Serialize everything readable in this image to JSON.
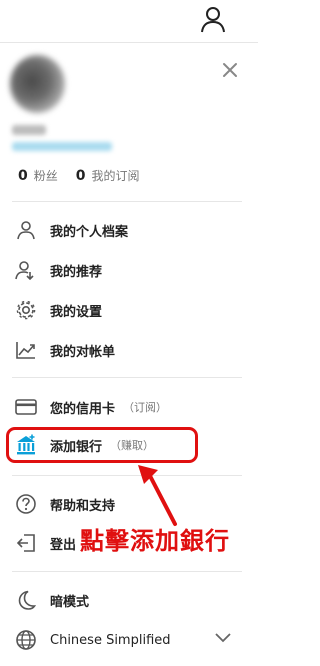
{
  "stats": {
    "followers_count": "0",
    "followers_label": "粉丝",
    "subscriptions_count": "0",
    "subscriptions_label": "我的订阅"
  },
  "menu": {
    "profile": "我的个人档案",
    "recommendations": "我的推荐",
    "settings": "我的设置",
    "statement": "我的对帐单",
    "credit_card": "您的信用卡",
    "credit_card_note": "（订阅）",
    "add_bank": "添加银行",
    "add_bank_note": "（赚取）",
    "help": "帮助和支持",
    "logout": "登出",
    "dark_mode": "暗模式",
    "language": "Chinese Simplified"
  },
  "annotation": {
    "text": "點擊添加銀行",
    "color": "#e01010"
  },
  "colors": {
    "accent": "#0a9fd8",
    "highlight": "#e01010"
  },
  "icons": [
    "user-icon",
    "close-icon",
    "person-icon",
    "person-add-icon",
    "gear-icon",
    "chart-icon",
    "credit-card-icon",
    "bank-icon",
    "help-icon",
    "logout-icon",
    "moon-icon",
    "globe-icon",
    "chevron-down-icon"
  ]
}
